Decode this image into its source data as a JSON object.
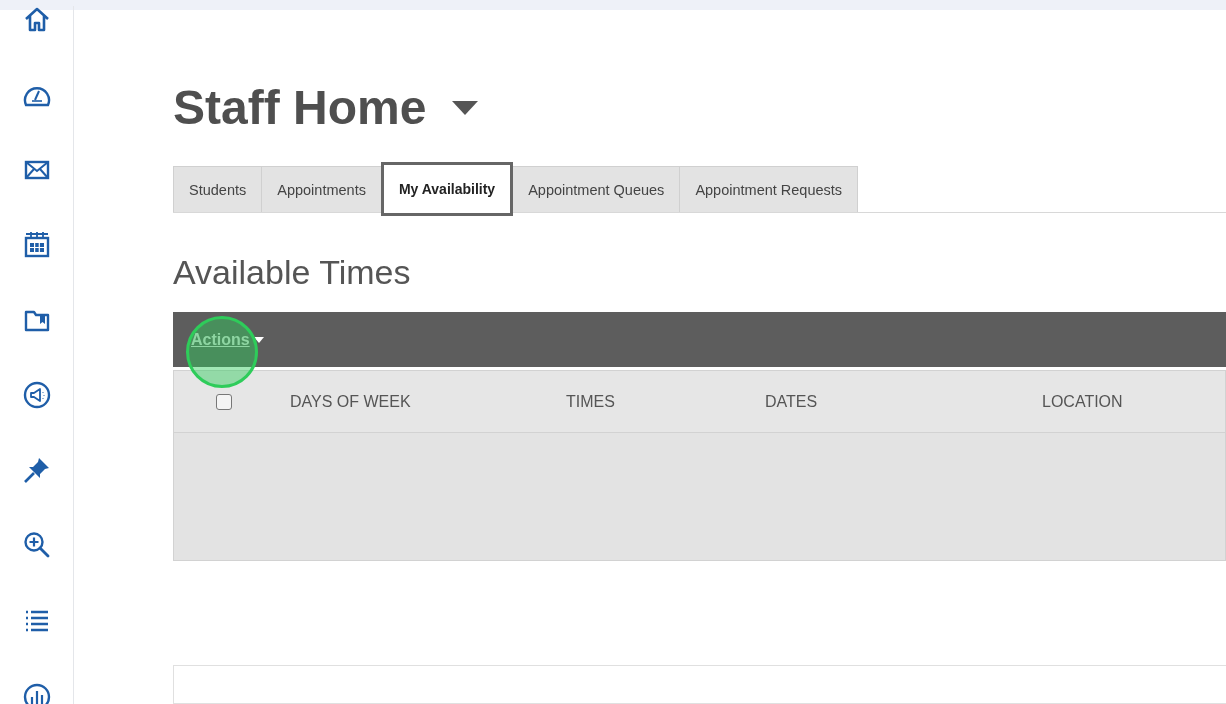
{
  "page": {
    "title": "Staff Home"
  },
  "tabs": [
    {
      "label": "Students",
      "selected": false
    },
    {
      "label": "Appointments",
      "selected": false
    },
    {
      "label": "My Availability",
      "selected": true
    },
    {
      "label": "Appointment Queues",
      "selected": false
    },
    {
      "label": "Appointment Requests",
      "selected": false
    }
  ],
  "section": {
    "title": "Available Times"
  },
  "table": {
    "actions": "Actions",
    "select_all": {
      "checked": false
    },
    "columns": [
      "DAYS OF WEEK",
      "TIMES",
      "DATES",
      "LOCATION"
    ]
  }
}
